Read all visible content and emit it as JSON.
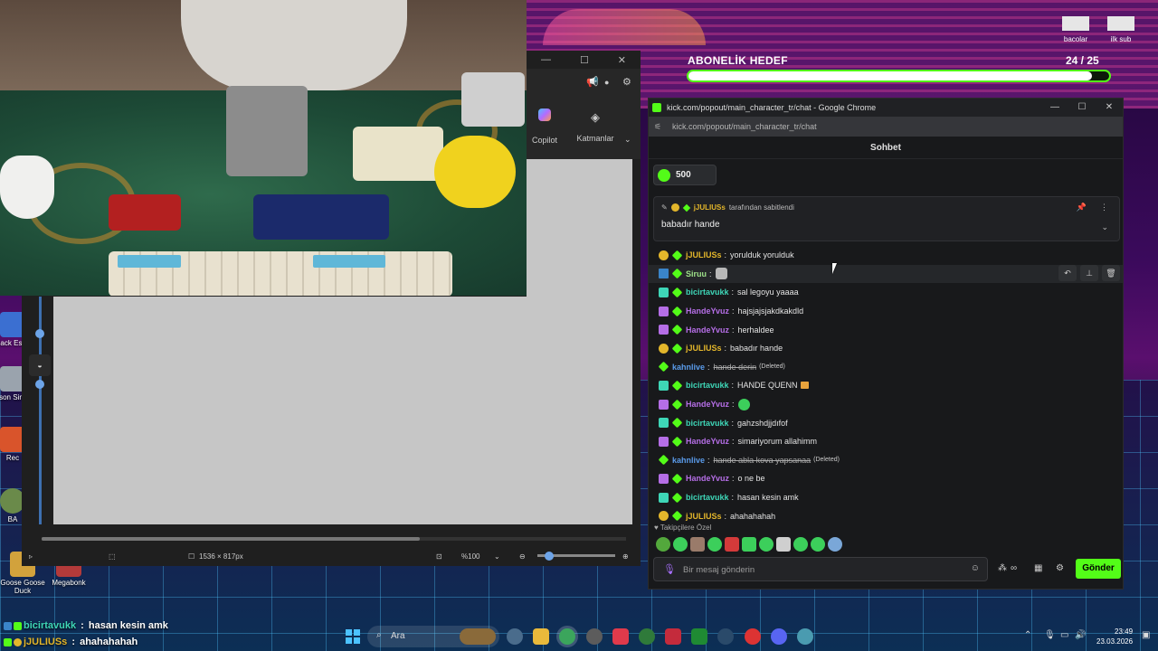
{
  "editor": {
    "copilot_label": "Copilot",
    "layers_label": "Katmanlar",
    "dimensions": "1536 × 817px",
    "zoom": "%100"
  },
  "desktop_icons": [
    {
      "label": "Back Esca",
      "color": "#3b6fd1"
    },
    {
      "label": "Prison Simula",
      "color": "#9aa3ad"
    },
    {
      "label": "Rec",
      "color": "#d9542b"
    },
    {
      "label": "BA",
      "color": "#6a8a4a"
    },
    {
      "label": "Goose Goose Duck",
      "color": "#d2a23c"
    },
    {
      "label": "Megabonk",
      "color": "#b33a3a"
    }
  ],
  "top_icons": [
    {
      "label": "bacolar"
    },
    {
      "label": "ilk sub"
    }
  ],
  "goal": {
    "title": "ABONELİK HEDEF",
    "count": "24  / 25",
    "progress": 0.96
  },
  "chrome": {
    "title": "kick.com/popout/main_character_tr/chat - Google Chrome",
    "url": "kick.com/popout/main_character_tr/chat"
  },
  "chat": {
    "header": "Sohbet",
    "kick_count": "500",
    "pinned": {
      "by_user": "jJULIUSs",
      "by_suffix": "tarafından sabitlendi",
      "message": "babadır hande"
    },
    "messages": [
      {
        "user": "jJULIUSs",
        "color": "#e3b62b",
        "badge": "gold",
        "text": "yorulduk yorulduk",
        "deleted": false
      },
      {
        "user": "Siruu",
        "color": "#9fe28a",
        "badge": "blue",
        "text": "",
        "emote": "grey",
        "deleted": false
      },
      {
        "user": "bicirtavukk",
        "color": "#3ed6b7",
        "badge": "teal",
        "text": "sal legoyu yaaaa",
        "deleted": false
      },
      {
        "user": "HandeYvuz",
        "color": "#b56ee6",
        "badge": "purple",
        "text": "hajsjajsjakdkakdld",
        "deleted": false
      },
      {
        "user": "HandeYvuz",
        "color": "#b56ee6",
        "badge": "purple",
        "text": "herhaldee",
        "deleted": false
      },
      {
        "user": "jJULIUSs",
        "color": "#e3b62b",
        "badge": "gold",
        "text": "babadır hande",
        "deleted": false
      },
      {
        "user": "kahnlive",
        "color": "#5a9bea",
        "badge": "",
        "text": "hande derin",
        "deleted": true,
        "deleted_tag": "(Deleted)"
      },
      {
        "user": "bicirtavukk",
        "color": "#3ed6b7",
        "badge": "teal",
        "text": "HANDE QUENN",
        "emote": "crown",
        "deleted": false
      },
      {
        "user": "HandeYvuz",
        "color": "#b56ee6",
        "badge": "purple",
        "text": "",
        "emote": "green",
        "deleted": false
      },
      {
        "user": "bicirtavukk",
        "color": "#3ed6b7",
        "badge": "teal",
        "text": "gahzshdjjdıfof",
        "deleted": false
      },
      {
        "user": "HandeYvuz",
        "color": "#b56ee6",
        "badge": "purple",
        "text": "simariyorum allahimm",
        "deleted": false
      },
      {
        "user": "kahnlive",
        "color": "#5a9bea",
        "badge": "",
        "text": "hande abla kova yapsanaa",
        "deleted": true,
        "deleted_tag": "(Deleted)"
      },
      {
        "user": "HandeYvuz",
        "color": "#b56ee6",
        "badge": "purple",
        "text": "o ne be",
        "deleted": false
      },
      {
        "user": "bicirtavukk",
        "color": "#3ed6b7",
        "badge": "teal",
        "text": "hasan kesin amk",
        "deleted": false
      },
      {
        "user": "jJULIUSs",
        "color": "#e3b62b",
        "badge": "gold",
        "text": "ahahahahah",
        "deleted": false
      }
    ],
    "emotes_label": "♥ Takipçilere Özel",
    "input_placeholder": "Bir mesaj gönderin",
    "send_label": "Gönder"
  },
  "overlay_messages": [
    {
      "user": "bicirtavukk",
      "text": "hasan kesin amk",
      "color": "#3ed6b7"
    },
    {
      "user": "jJULIUSs",
      "text": "ahahahahah",
      "color": "#e3b62b"
    }
  ],
  "taskbar": {
    "search_label": "Ara",
    "time": "23:49",
    "date": "23.03.2026"
  },
  "colors": {
    "kick_green": "#53fc18",
    "chat_bg": "#18191b"
  }
}
